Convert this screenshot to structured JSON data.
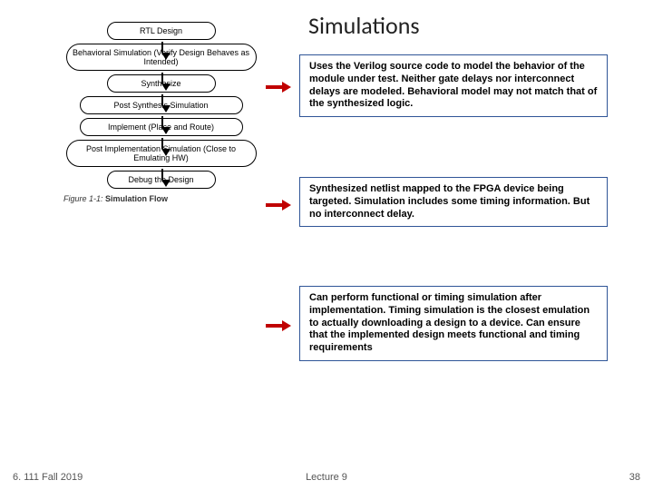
{
  "title": "Simulations",
  "flow": {
    "nodes": {
      "rtl": "RTL Design",
      "behavioral": "Behavioral Simulation\n(Verify Design Behaves as Intended)",
      "synthesize": "Synthesize",
      "postsynth": "Post Synthesis Simulation",
      "implement": "Implement (Place and Route)",
      "postimpl": "Post Implementation Simulation\n(Close to Emulating HW)",
      "debug": "Debug the Design"
    },
    "caption_num": "Figure 1-1:",
    "caption_title": "Simulation Flow"
  },
  "callouts": {
    "c1": "Uses the Verilog source code to model the behavior of the module under test. Neither gate delays nor interconnect delays are modeled. Behavioral model may not match that of the synthesized logic.",
    "c2": "Synthesized netlist  mapped to the FPGA device being targeted. Simulation includes some timing information. But no interconnect delay.",
    "c3": "Can perform functional or timing simulation after implementation.  Timing simulation is the closest emulation to actually downloading a design to a device.  Can ensure that the implemented design meets functional and timing requirements"
  },
  "footer": {
    "left": "6. 111 Fall 2019",
    "center": "Lecture 9",
    "right": "38"
  }
}
